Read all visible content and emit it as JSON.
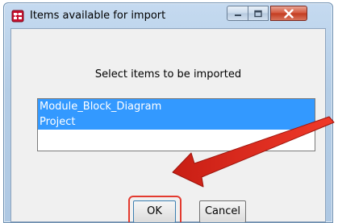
{
  "window": {
    "title": "Items available for import",
    "controls": {
      "minimize_icon": "minimize-icon",
      "maximize_icon": "maximize-icon",
      "close_icon": "close-icon"
    }
  },
  "dialog": {
    "prompt": "Select items to be imported",
    "items": [
      {
        "label": "Module_Block_Diagram",
        "selected": true
      },
      {
        "label": "Project",
        "selected": true
      }
    ],
    "ok_label": "OK",
    "cancel_label": "Cancel"
  },
  "annotation": {
    "color": "#e33a2f"
  }
}
